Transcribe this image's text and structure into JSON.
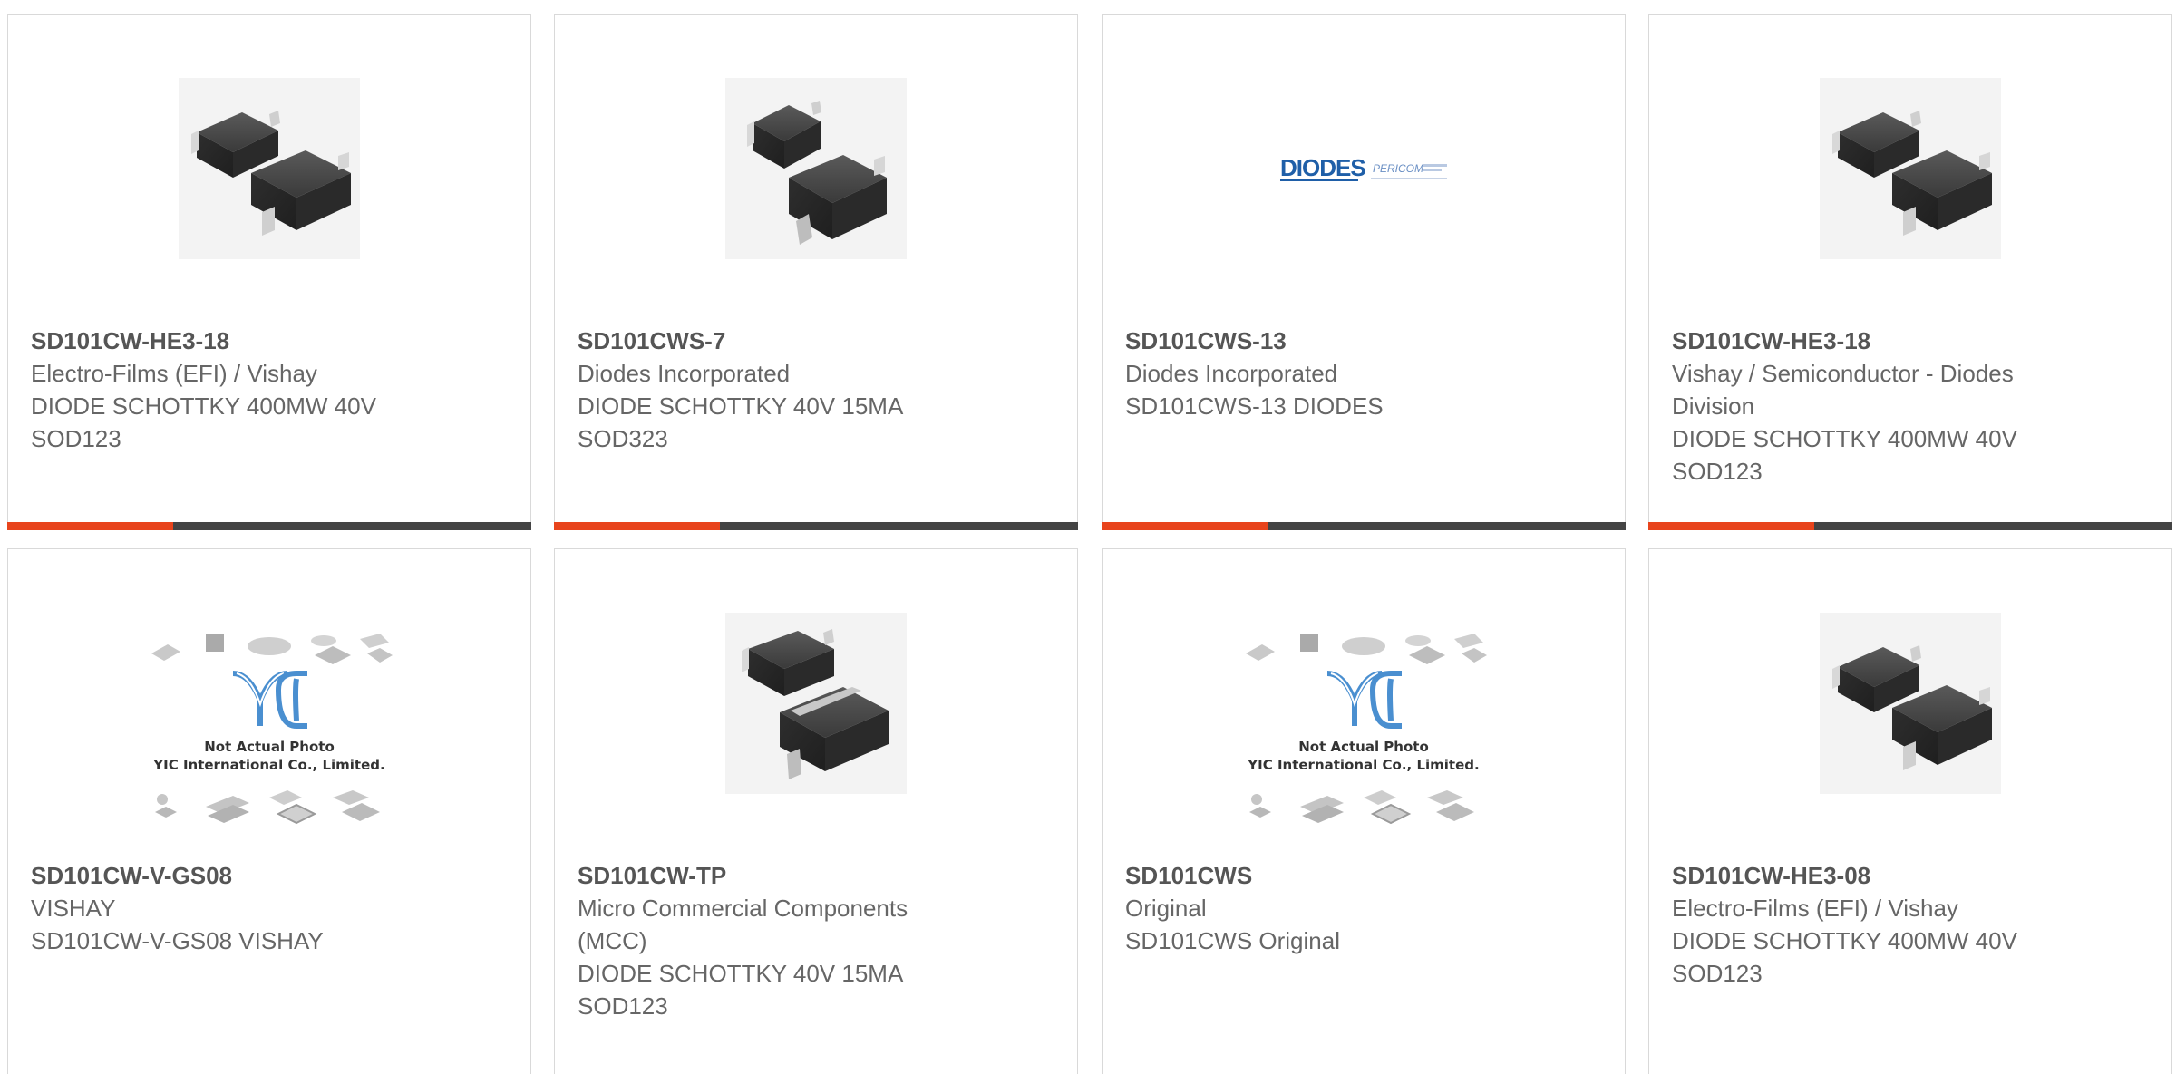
{
  "colors": {
    "accent": "#e8441c",
    "bar_dark": "#444444",
    "text": "#666666",
    "part_number": "#555555",
    "diodes_blue": "#1f5fa8"
  },
  "products": [
    {
      "part_number": "SD101CW-HE3-18",
      "manufacturer": "Electro-Films (EFI) / Vishay",
      "description": "DIODE SCHOTTKY 400MW 40V SOD123",
      "image": "sod123-package-photo"
    },
    {
      "part_number": "SD101CWS-7",
      "manufacturer": "Diodes Incorporated",
      "description": "DIODE SCHOTTKY 40V 15MA SOD323",
      "image": "sod323-package-photo"
    },
    {
      "part_number": "SD101CWS-13",
      "manufacturer": "Diodes Incorporated",
      "description": "SD101CWS-13 DIODES",
      "image": "diodes-pericom-logo",
      "logo_text": "DIODES",
      "logo_subtext": "PERICOM"
    },
    {
      "part_number": "SD101CW-HE3-18",
      "manufacturer": "Vishay / Semiconductor - Diodes Division",
      "description": "DIODE SCHOTTKY 400MW 40V SOD123",
      "image": "sod123-package-photo"
    },
    {
      "part_number": "SD101CW-V-GS08",
      "manufacturer": "VISHAY",
      "description": "SD101CW-V-GS08 VISHAY",
      "image": "yic-placeholder",
      "placeholder_line1": "Not Actual Photo",
      "placeholder_line2": "YIC International Co., Limited."
    },
    {
      "part_number": "SD101CW-TP",
      "manufacturer": "Micro Commercial Components (MCC)",
      "description": "DIODE SCHOTTKY 40V 15MA SOD123",
      "image": "sod123-package-photo"
    },
    {
      "part_number": "SD101CWS",
      "manufacturer": "Original",
      "description": "SD101CWS Original",
      "image": "yic-placeholder",
      "placeholder_line1": "Not Actual Photo",
      "placeholder_line2": "YIC International Co., Limited."
    },
    {
      "part_number": "SD101CW-HE3-08",
      "manufacturer": "Electro-Films (EFI) / Vishay",
      "description": "DIODE SCHOTTKY 400MW 40V SOD123",
      "image": "sod123-package-photo"
    }
  ]
}
